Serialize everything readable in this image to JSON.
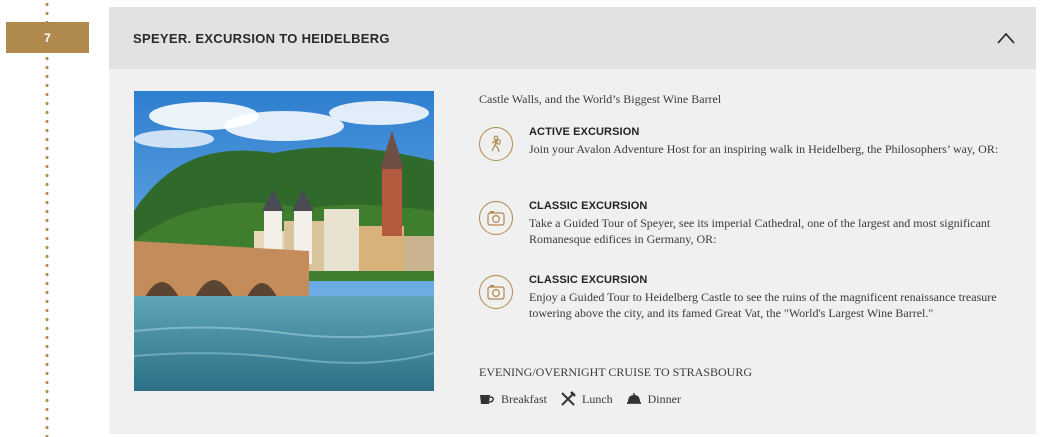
{
  "timeline": {
    "day_number": "7"
  },
  "header": {
    "title": "SPEYER. EXCURSION TO HEIDELBERG"
  },
  "image": {
    "alt": "Heidelberg old bridge and castle over the river"
  },
  "intro": "Castle Walls, and the World’s Biggest Wine Barrel",
  "excursions": [
    {
      "title": "ACTIVE EXCURSION",
      "icon": "hiking-icon",
      "text": "Join your Avalon Adventure Host for an inspiring walk in Heidelberg, the Philosophers’ way, OR:"
    },
    {
      "title": "CLASSIC EXCURSION",
      "icon": "camera-icon",
      "text": "Take a Guided Tour of Speyer, see its imperial Cathedral, one of the largest and most significant Romanesque edifices in Germany, OR:"
    },
    {
      "title": "CLASSIC EXCURSION",
      "icon": "camera-icon",
      "text": "Enjoy a Guided Tour to Heidelberg Castle to see the ruins of the magnificent renaissance treasure towering above the city, and its famed Great Vat, the \"World's Largest Wine Barrel.\""
    }
  ],
  "evening": "EVENING/OVERNIGHT CRUISE TO STRASBOURG",
  "meals": [
    {
      "label": "Breakfast",
      "icon": "coffee-cup-icon"
    },
    {
      "label": "Lunch",
      "icon": "fork-knife-icon"
    },
    {
      "label": "Dinner",
      "icon": "cloche-icon"
    }
  ],
  "colors": {
    "accent": "#b0894c",
    "card_bg": "#f0f0f0",
    "header_bg": "#e2e2e2"
  }
}
